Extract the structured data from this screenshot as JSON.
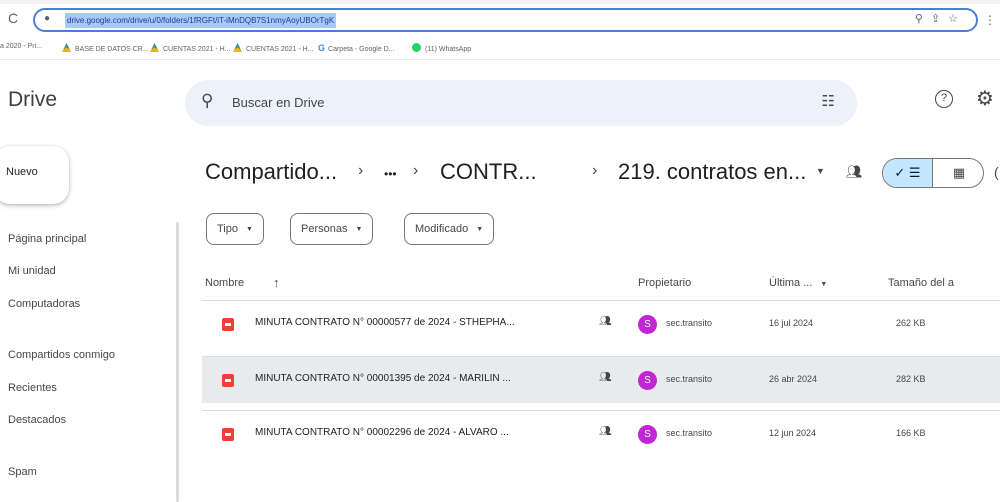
{
  "browser": {
    "url": "drive.google.com/drive/u/0/folders/1fRGFt/iT-iMnDQB7S1nmyAoyUBOrTgK",
    "bookmarks": [
      {
        "label": "a 2020 - Pri...",
        "icon": "none"
      },
      {
        "label": "BASE DE DATOS CR...",
        "icon": "drive-icon"
      },
      {
        "label": "CUENTAS 2021 - H...",
        "icon": "drive-icon"
      },
      {
        "label": "CUENTAS 2021 - H...",
        "icon": "drive-icon"
      },
      {
        "label": "Carpeta - Google D...",
        "icon": "google-icon"
      },
      {
        "label": "(11) WhatsApp",
        "icon": "whatsapp-icon"
      }
    ]
  },
  "header": {
    "app_title": "Drive",
    "search_placeholder": "Buscar en Drive"
  },
  "sidebar": {
    "new_label": "Nuevo",
    "items": [
      {
        "label": "Página principal"
      },
      {
        "label": "Mi unidad"
      },
      {
        "label": "Computadoras"
      },
      {
        "label": "Compartidos conmigo"
      },
      {
        "label": "Recientes"
      },
      {
        "label": "Destacados"
      },
      {
        "label": "Spam"
      }
    ]
  },
  "breadcrumb": {
    "items": [
      "Compartido...",
      "•••",
      "CONTR...",
      "219. contratos en..."
    ],
    "separator": "›"
  },
  "filters": [
    {
      "label": "Tipo"
    },
    {
      "label": "Personas"
    },
    {
      "label": "Modificado"
    }
  ],
  "table": {
    "columns": {
      "name": "Nombre",
      "owner": "Propietario",
      "modified": "Última ...",
      "size": "Tamaño del a"
    },
    "rows": [
      {
        "name": "MINUTA CONTRATO N° 00000577 de 2024 - STHEPHA...",
        "owner_initial": "S",
        "owner": "sec.transito",
        "modified": "16 jul 2024",
        "size": "262 KB",
        "highlighted": false
      },
      {
        "name": "MINUTA CONTRATO N° 00001395 de 2024 - MARILIN ...",
        "owner_initial": "S",
        "owner": "sec.transito",
        "modified": "26 abr 2024",
        "size": "282 KB",
        "highlighted": true
      },
      {
        "name": "MINUTA CONTRATO N° 00002296 de 2024 - ALVARO ...",
        "owner_initial": "S",
        "owner": "sec.transito",
        "modified": "12 jun 2024",
        "size": "166 KB",
        "highlighted": false
      }
    ]
  },
  "colors": {
    "accent": "#c2e7ff",
    "search_bg": "#edf1fa",
    "pdf_icon": "#ea4335",
    "avatar": "#c026d3",
    "row_highlight": "#e8eaed"
  }
}
